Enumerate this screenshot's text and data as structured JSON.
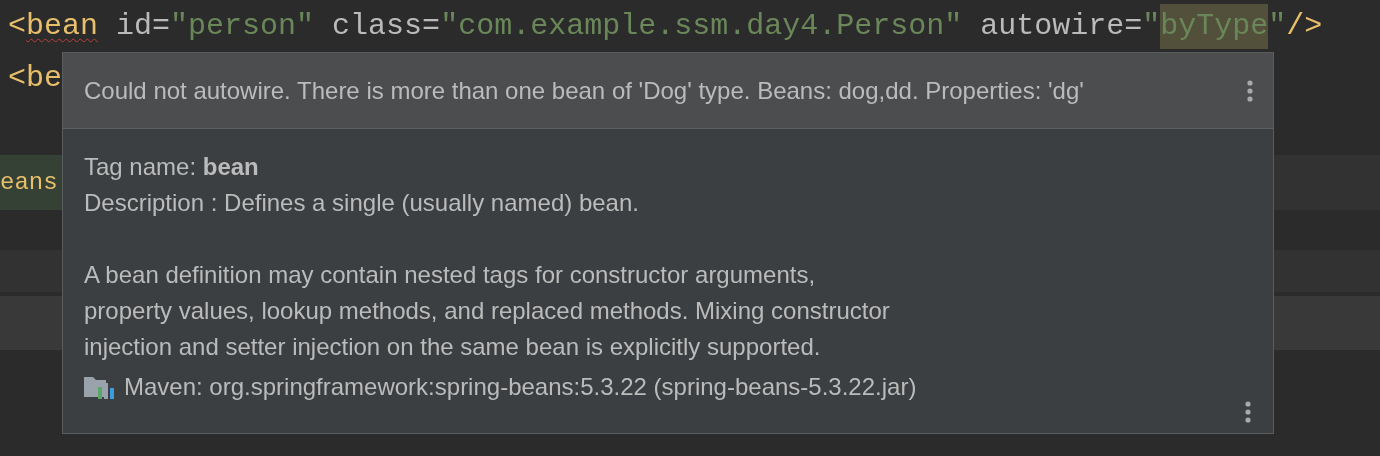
{
  "code_lines": [
    {
      "tokens": [
        {
          "kind": "tag",
          "text": "<"
        },
        {
          "kind": "tag",
          "text": "bean",
          "error": true
        },
        {
          "kind": "attr",
          "text": "id"
        },
        {
          "kind": "punct",
          "text": "="
        },
        {
          "kind": "value",
          "text": "\"person\""
        },
        {
          "kind": "attr",
          "text": "class"
        },
        {
          "kind": "punct",
          "text": "="
        },
        {
          "kind": "value",
          "text": "\"com.example.ssm.day4.Person\""
        },
        {
          "kind": "attr",
          "text": "autowire"
        },
        {
          "kind": "punct",
          "text": "="
        },
        {
          "kind": "value",
          "text": "\""
        },
        {
          "kind": "value",
          "text": "byType",
          "highlighted": true
        },
        {
          "kind": "value",
          "text": "\""
        },
        {
          "kind": "tag",
          "text": "/>"
        }
      ]
    },
    {
      "tokens": [
        {
          "kind": "tag",
          "text": "<be"
        }
      ]
    },
    {
      "tokens": [
        {
          "kind": "tag",
          "text": "eans"
        }
      ],
      "highlighted": true
    }
  ],
  "popup": {
    "problem": "Could not autowire. There is more than one bean of 'Dog' type. Beans: dog,dd. Properties: 'dg'",
    "tag_name": "Tag name: **bean**",
    "description": "Description : Defines a single (usually named) bean.",
    "paragraph": "A bean definition may contain nested tags for constructor arguments,\nproperty values, lookup methods, and replaced methods. Mixing constructor\ninjection and setter injection on the same bean is explicitly supported.",
    "library": "Maven: org.springframework:spring-beans:5.3.22 (spring-beans-5.3.22.jar)"
  }
}
